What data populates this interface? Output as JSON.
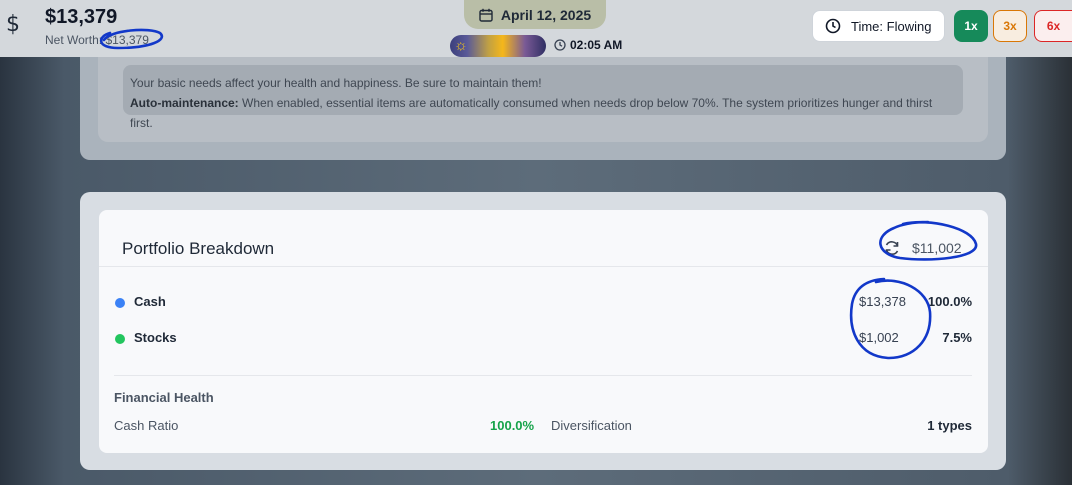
{
  "header": {
    "currency_icon": "dollar-icon",
    "balance": "$13,379",
    "net_worth_label": "Net Worth:",
    "net_worth_value": "$13,379",
    "date_icon": "calendar-icon",
    "date": "April 12, 2025",
    "daylight_icon": "sun-icon",
    "time_icon": "clock-icon",
    "time": "02:05 AM",
    "time_mode_icon": "clock-icon",
    "time_mode": "Time: Flowing",
    "speed_buttons": [
      "1x",
      "3x",
      "6x"
    ],
    "active_speed": "1x"
  },
  "needs_info": {
    "line1": "Your basic needs affect your health and happiness. Be sure to maintain them!",
    "line2_bold": "Auto-maintenance:",
    "line2_rest": " When enabled, essential items are automatically consumed when needs drop below 70%. The system prioritizes hunger and thirst first."
  },
  "portfolio": {
    "title": "Portfolio Breakdown",
    "refresh_icon": "refresh-icon",
    "total": "$11,002",
    "assets": [
      {
        "name": "Cash",
        "value": "$13,378",
        "percent": "100.0%",
        "color": "#3b82f6"
      },
      {
        "name": "Stocks",
        "value": "$1,002",
        "percent": "7.5%",
        "color": "#22c55e"
      }
    ],
    "financial_health": {
      "title": "Financial Health",
      "cash_ratio_label": "Cash Ratio",
      "cash_ratio_value": "100.0%",
      "diversification_label": "Diversification",
      "diversification_value": "1 types"
    }
  },
  "colors": {
    "accent_green": "#168a5a",
    "speed_3x": "#d97706",
    "speed_6x": "#dc2626",
    "positive": "#16a34a",
    "annotation": "#1238c9"
  }
}
